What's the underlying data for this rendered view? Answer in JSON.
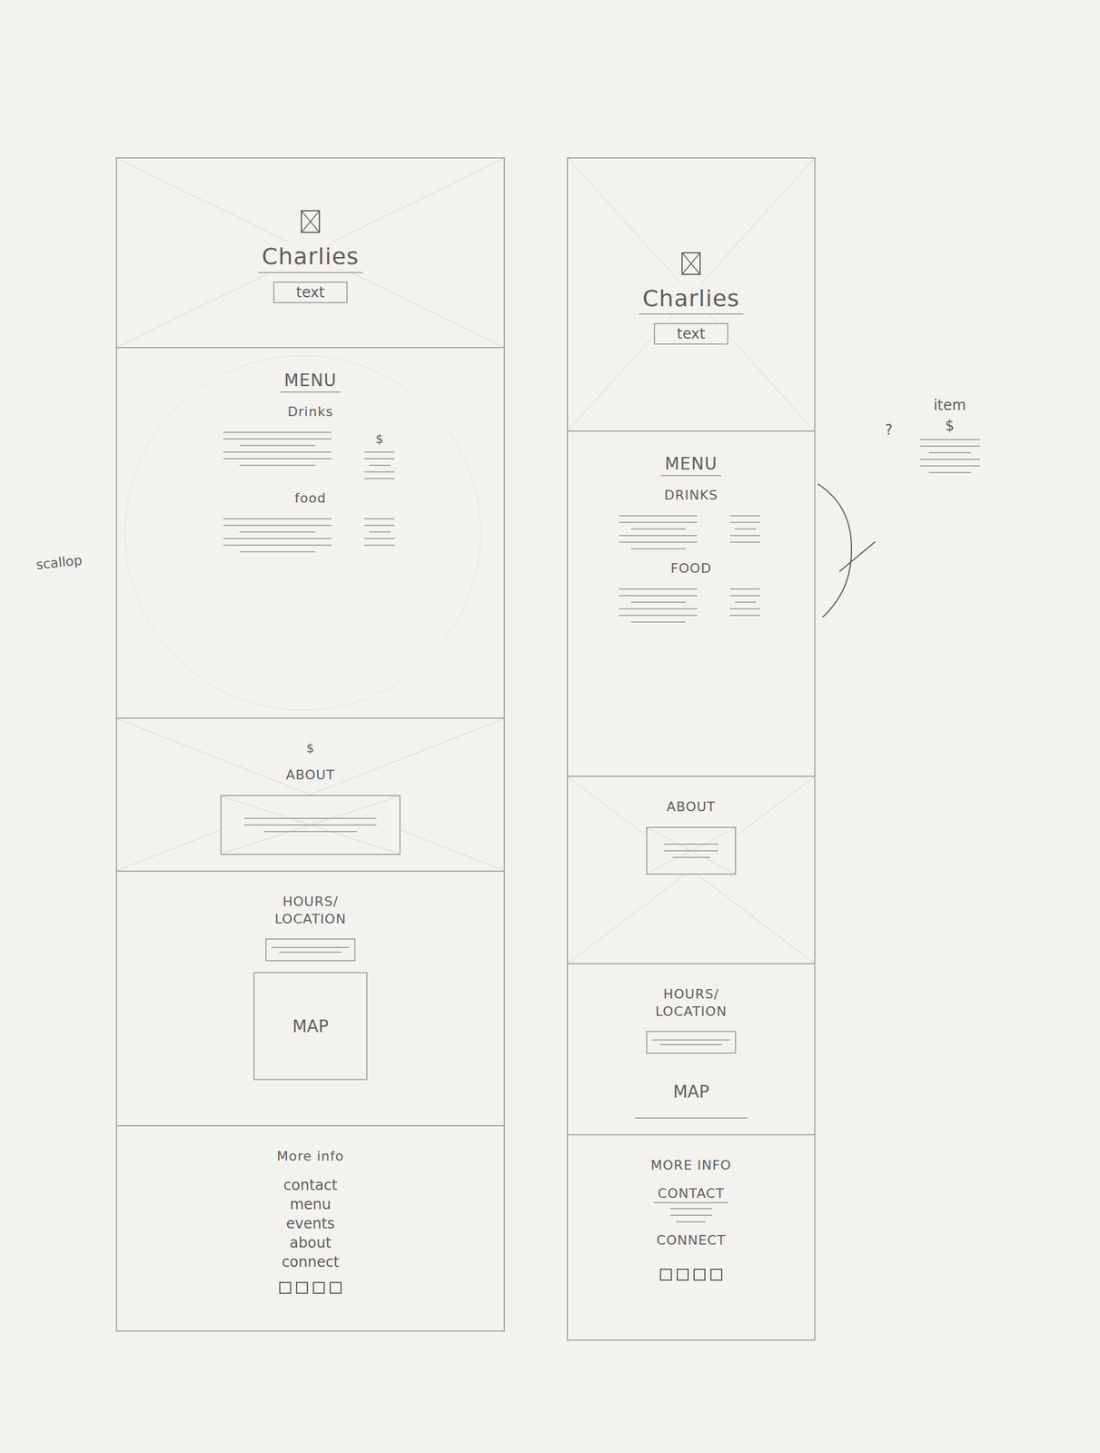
{
  "margin_note": "scallop",
  "wireframes": [
    {
      "hero": {
        "title": "Charlies",
        "text": "text"
      },
      "menu": {
        "title": "MENU",
        "sections": [
          {
            "label": "Drinks",
            "price": "$"
          },
          {
            "label": "food"
          }
        ]
      },
      "about": {
        "title": "ABOUT",
        "mark": "$"
      },
      "hours": {
        "title": "HOURS/ LOCATION",
        "map": "MAP"
      },
      "footer": {
        "title": "More info",
        "items": [
          {
            "kind": "link",
            "label": "contact"
          },
          {
            "kind": "link",
            "label": "menu"
          },
          {
            "kind": "link",
            "label": "events"
          },
          {
            "kind": "link",
            "label": "about"
          },
          {
            "kind": "link",
            "label": "connect"
          }
        ]
      }
    },
    {
      "hero": {
        "title": "Charlies",
        "text": "text"
      },
      "menu": {
        "title": "MENU",
        "sections": [
          {
            "label": "DRINKS"
          },
          {
            "label": "FOOD"
          }
        ]
      },
      "about": {
        "title": "ABOUT"
      },
      "hours": {
        "title": "HOURS/ LOCATION",
        "map": "MAP"
      },
      "footer": {
        "title": "MORE INFO",
        "items": [
          {
            "kind": "block",
            "label": "CONTACT"
          },
          {
            "kind": "heading",
            "label": "CONNECT"
          }
        ]
      }
    }
  ],
  "side_note": {
    "question": "?",
    "label": "item",
    "price": "$"
  }
}
